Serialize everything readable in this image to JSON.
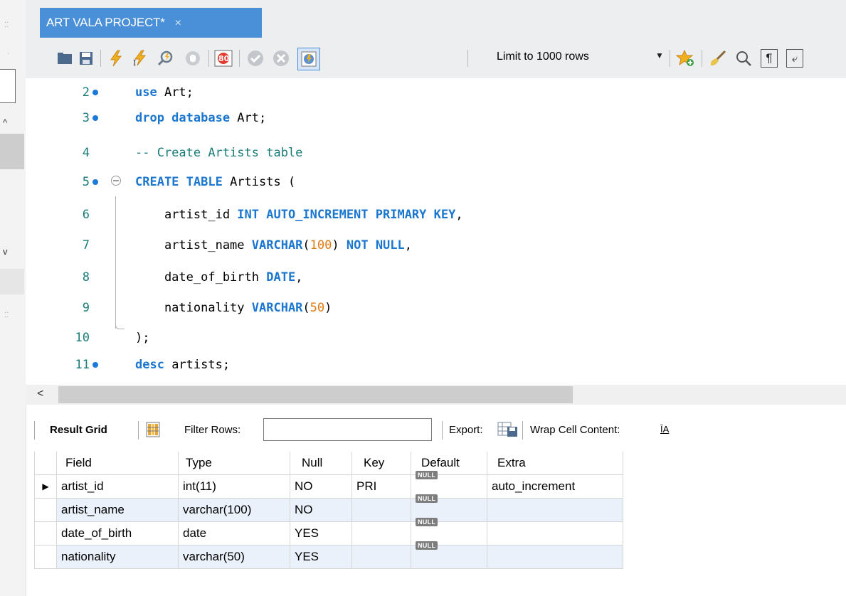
{
  "tab": {
    "title": "ART VALA PROJECT*",
    "close_glyph": "×"
  },
  "toolbar": {
    "icons": [
      "open-folder-icon",
      "save-icon",
      "execute-lightning-icon",
      "execute-cursor-lightning-icon",
      "explain-magnifier-icon",
      "stop-hand-icon",
      "toggle-error-icon",
      "commit-check-icon",
      "rollback-x-icon",
      "autocommit-toggle-icon",
      "bookmark-star-icon",
      "beautify-brush-icon",
      "find-magnifier-icon",
      "invisible-chars-pilcrow-icon",
      "wrap-lines-icon"
    ],
    "limit_label": "Limit to 1000 rows"
  },
  "editor": {
    "lines": [
      {
        "num": "2"
      },
      {
        "num": "3"
      },
      {
        "num": "4"
      },
      {
        "num": "5"
      },
      {
        "num": "6"
      },
      {
        "num": "7"
      },
      {
        "num": "8"
      },
      {
        "num": "9"
      },
      {
        "num": "10"
      },
      {
        "num": "11"
      }
    ],
    "tokens": {
      "l2_kw": "use",
      "l2_rest": " Art;",
      "l3_kw": "drop database",
      "l3_rest": " Art;",
      "l4_cm": "-- Create Artists table",
      "l5_kw": "CREATE TABLE",
      "l5_rest": " Artists (",
      "l6_a": "    artist_id ",
      "l6_kw": "INT AUTO_INCREMENT PRIMARY KEY",
      "l6_b": ",",
      "l7_a": "    artist_name ",
      "l7_kw1": "VARCHAR",
      "l7_p1": "(",
      "l7_num": "100",
      "l7_p2": ") ",
      "l7_kw2": "NOT NULL",
      "l7_b": ",",
      "l8_a": "    date_of_birth ",
      "l8_kw": "DATE",
      "l8_b": ",",
      "l9_a": "    nationality ",
      "l9_kw": "VARCHAR",
      "l9_p1": "(",
      "l9_num": "50",
      "l9_p2": ")",
      "l10": ");",
      "l11_kw": "desc",
      "l11_rest": " artists;"
    }
  },
  "result_toolbar": {
    "result_grid": "Result Grid",
    "filter_rows": "Filter Rows:",
    "filter_value": "",
    "export": "Export:",
    "wrap": "Wrap Cell Content:",
    "wrap_glyph": "ĪA"
  },
  "grid": {
    "columns": [
      "Field",
      "Type",
      "Null",
      "Key",
      "Default",
      "Extra"
    ],
    "null_label": "NULL",
    "rows": [
      {
        "field": "artist_id",
        "type": "int(11)",
        "null": "NO",
        "key": "PRI",
        "extra": "auto_increment"
      },
      {
        "field": "artist_name",
        "type": "varchar(100)",
        "null": "NO",
        "key": "",
        "extra": ""
      },
      {
        "field": "date_of_birth",
        "type": "date",
        "null": "YES",
        "key": "",
        "extra": ""
      },
      {
        "field": "nationality",
        "type": "varchar(50)",
        "null": "YES",
        "key": "",
        "extra": ""
      }
    ],
    "current_row_marker": "▶"
  }
}
